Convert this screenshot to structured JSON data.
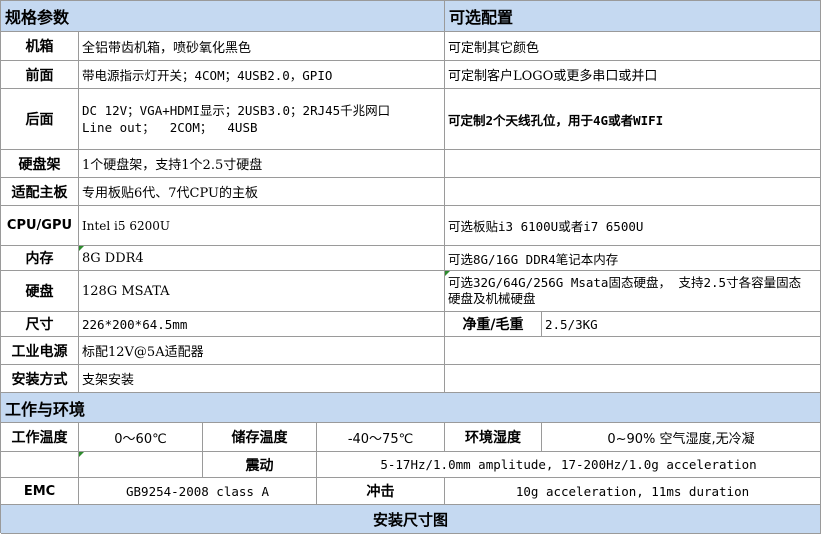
{
  "spec_header": "规格参数",
  "options_header": "可选配置",
  "rows": {
    "case": {
      "label": "机箱",
      "value": "全铝带齿机箱，喷砂氧化黑色",
      "option": "可定制其它颜色"
    },
    "front": {
      "label": "前面",
      "value": "带电源指示灯开关；4COM；4USB2.0，GPIO",
      "option": "可定制客户LOGO或更多串口或并口"
    },
    "rear": {
      "label": "后面",
      "value_line1": "DC 12V；VGA+HDMI显示；2USB3.0；2RJ45千兆网口",
      "value_line2": "Line out；  2COM；  4USB",
      "option": "可定制2个天线孔位，用于4G或者WIFI"
    },
    "drive_bay": {
      "label": "硬盘架",
      "value": "1个硬盘架，支持1个2.5寸硬盘",
      "option": ""
    },
    "board": {
      "label": "适配主板",
      "value": "专用板贴6代、7代CPU的主板",
      "option": ""
    },
    "cpu": {
      "label": "CPU/GPU",
      "value": "Intel i5 6200U",
      "option": "可选板贴i3 6100U或者i7 6500U"
    },
    "memory": {
      "label": "内存",
      "value": "8G DDR4",
      "option": "可选8G/16G DDR4笔记本内存"
    },
    "disk": {
      "label": "硬盘",
      "value": "128G MSATA",
      "option": "可选32G/64G/256G Msata固态硬盘， 支持2.5寸各容量固态硬盘及机械硬盘"
    },
    "size": {
      "label": "尺寸",
      "value": "226*200*64.5mm",
      "weight_label": "净重/毛重",
      "weight_value": "2.5/3KG"
    },
    "power": {
      "label": "工业电源",
      "value": "标配12V@5A适配器",
      "option": ""
    },
    "mount": {
      "label": "安装方式",
      "value": "支架安装",
      "option": ""
    }
  },
  "env": {
    "header": "工作与环境",
    "work_temp_label": "工作温度",
    "work_temp_value": "0～60℃",
    "storage_temp_label": "储存温度",
    "storage_temp_value": "-40～75℃",
    "humidity_label": "环境湿度",
    "humidity_value": "0~90% 空气湿度,无冷凝",
    "vibration_label": "震动",
    "vibration_value": "5-17Hz/1.0mm amplitude, 17-200Hz/1.0g acceleration",
    "emc_label": "EMC",
    "emc_value": "GB9254-2008 class A",
    "shock_label": "冲击",
    "shock_value": "10g acceleration, 11ms duration"
  },
  "install_header": "安装尺寸图",
  "colors": {
    "header_bg": "#c5d9f1",
    "grid": "#9a9a9a",
    "marker": "#2e8b2e"
  }
}
